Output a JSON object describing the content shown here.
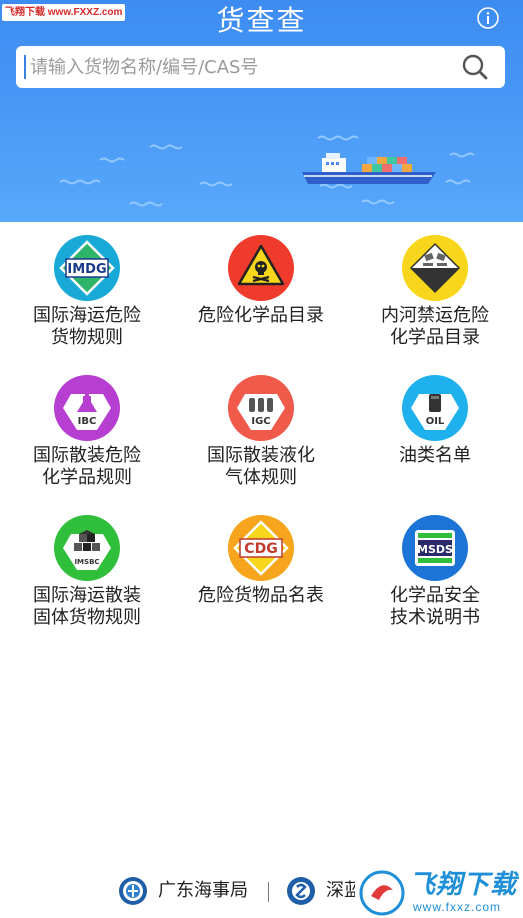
{
  "header": {
    "watermark": "飞翔下载 www.FXXZ.com",
    "title": "货查查",
    "info_icon": "info-icon",
    "search": {
      "placeholder": "请输入货物名称/编号/CAS号",
      "icon": "search-icon"
    }
  },
  "grid": {
    "items": [
      {
        "label": "国际海运危险\n货物规则",
        "icon": "imdg-icon",
        "icon_text": "IMDG",
        "color": "#18a9d6"
      },
      {
        "label": "危险化学品目录",
        "icon": "skull-hazard-icon",
        "icon_text": "",
        "color": "#ef3b2c"
      },
      {
        "label": "内河禁运危险\n化学品目录",
        "icon": "corrosive-icon",
        "icon_text": "",
        "color": "#f7d61b"
      },
      {
        "label": "国际散装危险\n化学品规则",
        "icon": "ibc-icon",
        "icon_text": "IBC",
        "color": "#b63ed0"
      },
      {
        "label": "国际散装液化\n气体规则",
        "icon": "igc-icon",
        "icon_text": "IGC",
        "color": "#f05a4a"
      },
      {
        "label": "油类名单",
        "icon": "oil-icon",
        "icon_text": "OIL",
        "color": "#1fb0ee"
      },
      {
        "label": "国际海运散装\n固体货物规则",
        "icon": "imsbc-icon",
        "icon_text": "IMSBC",
        "color": "#2fbf3a"
      },
      {
        "label": "危险货物品名表",
        "icon": "cdg-icon",
        "icon_text": "CDG",
        "color": "#f7a51c"
      },
      {
        "label": "化学品安全\n技术说明书",
        "icon": "msds-icon",
        "icon_text": "MSDS",
        "color": "#1c74d6"
      }
    ]
  },
  "footer": {
    "org1": "广东海事局",
    "org2": "深蓝",
    "watermark_text": "飞翔下载",
    "watermark_url": "www.fxxz.com"
  }
}
